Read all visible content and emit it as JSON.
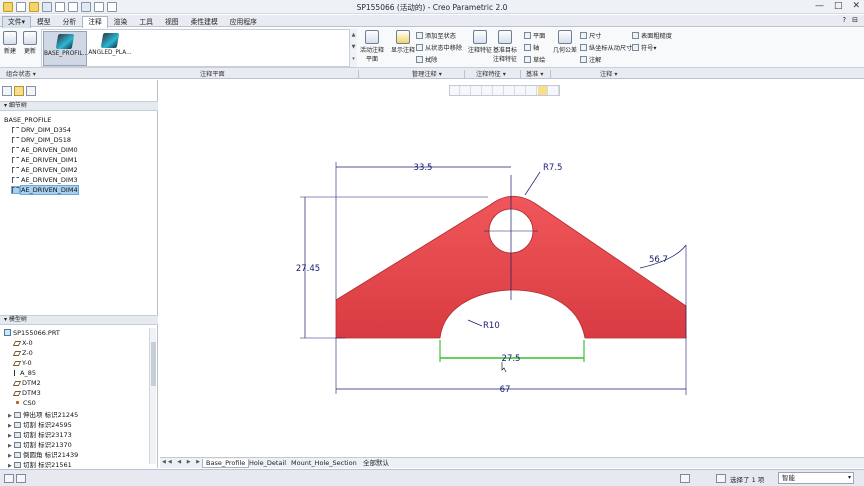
{
  "window": {
    "title": "SP155066 (活动的) - Creo Parametric 2.0",
    "minimize": "—",
    "maximize": "□",
    "close": "✕"
  },
  "menu": {
    "tabs": [
      "文件▾",
      "模型",
      "分析",
      "注释",
      "渲染",
      "工具",
      "视图",
      "柔性建模",
      "应用程序"
    ],
    "help": "?",
    "options": "⊟"
  },
  "ribbon": {
    "left_buttons": [
      {
        "label": "新建"
      },
      {
        "label": "更新"
      }
    ],
    "gallery": [
      {
        "label": "BASE_PROFIL..."
      },
      {
        "label": "ANGLED_PLA..."
      }
    ],
    "activate": {
      "label1": "活动注释",
      "label2": "平面"
    },
    "show": {
      "label": "显示注释"
    },
    "manage": [
      "添加至状态",
      "从状态中移除",
      "拭除"
    ],
    "feature": [
      {
        "label": "注释特征"
      },
      {
        "label1": "基准目标",
        "label2": "注释特征"
      }
    ],
    "datum": [
      "平面",
      "轴",
      "草绘"
    ],
    "geo_tol": {
      "label": "几何公差"
    },
    "annot": [
      "尺寸",
      "纵坐标从动尺寸",
      "注解"
    ],
    "annot2": [
      "表面粗糙度",
      "符号▾"
    ]
  },
  "groups": [
    "组合状态 ▾",
    "注释平面",
    "管理注释 ▾",
    "注释特征 ▾",
    "基准 ▾",
    "注释 ▾"
  ],
  "sidebar": {
    "layer_header": "▾ 细节树",
    "layer_items": [
      "BASE_PROFILE",
      "DRV_DIM_D354",
      "DRV_DIM_D518",
      "AE_DRIVEN_DIM0",
      "AE_DRIVEN_DIM1",
      "AE_DRIVEN_DIM2",
      "AE_DRIVEN_DIM3",
      "AE_DRIVEN_DIM4"
    ],
    "model_header": "▾ 模型树",
    "model_items": [
      "SP155066.PRT",
      "X-0",
      "Z-0",
      "Y-0",
      "A_85",
      "DTM2",
      "DTM3",
      "CS0",
      "伸出项 标识21245",
      "切割 标识24595",
      "切割 标识23173",
      "切割 标识21370",
      "倒圆角 标识21439",
      "切割 标识21561"
    ]
  },
  "drawing": {
    "dim_top": "33.5",
    "dim_radius_hole": "R7.5",
    "dim_height": "27.45",
    "dim_angle": "56.7",
    "dim_arc": "R10",
    "dim_slot": "27.5",
    "dim_total": "67",
    "colors": {
      "part": "#f0565a",
      "part_dark": "#d83c42",
      "dim": "#1a1a6e",
      "hl": "#39c033"
    }
  },
  "bottom_tabs": [
    "Base_Profile",
    "Hole_Detail",
    "Mount_Hole_Section",
    "全部默认"
  ],
  "status": {
    "selected": "选择了 1 项",
    "filter": "智能"
  }
}
